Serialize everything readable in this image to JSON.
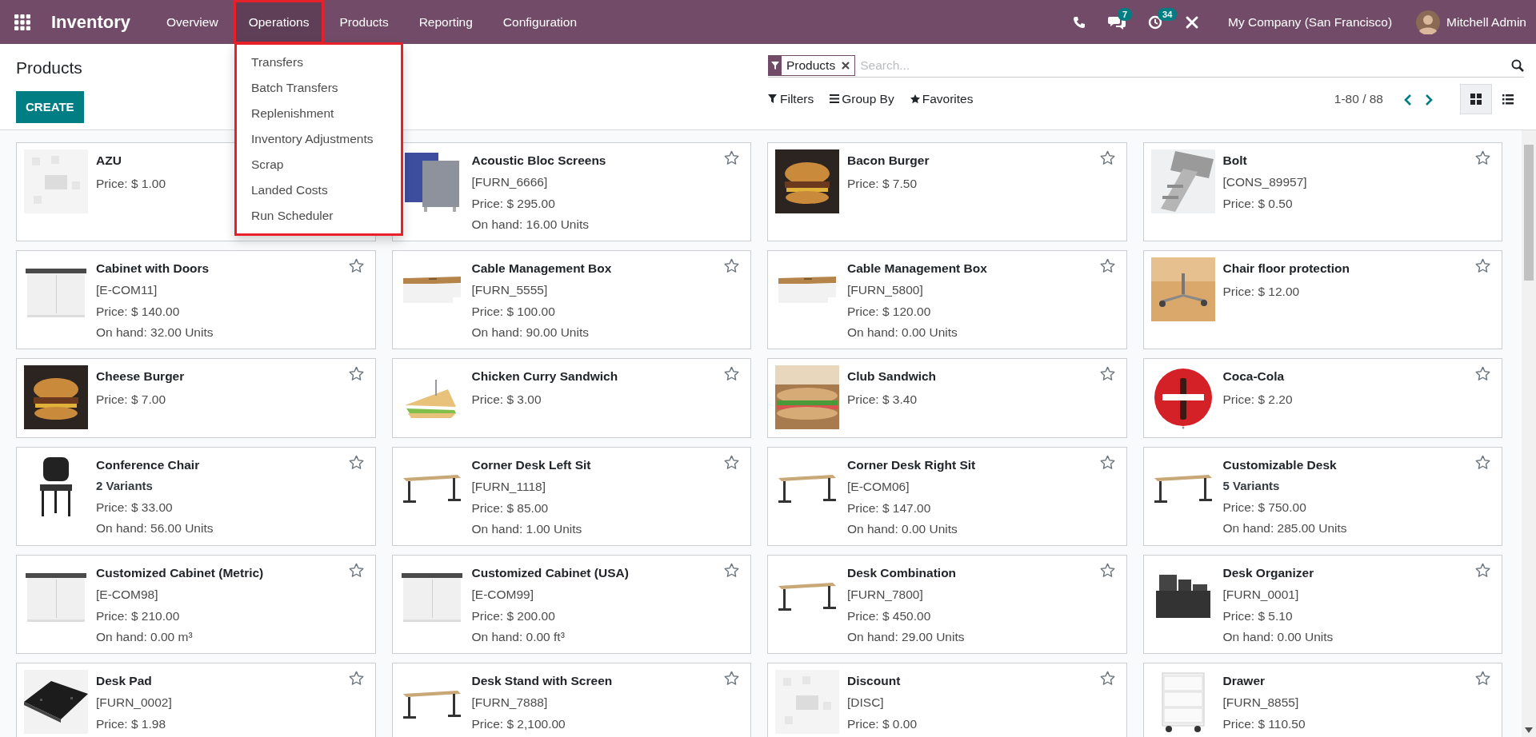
{
  "app": {
    "name": "Inventory"
  },
  "menu": [
    {
      "label": "Overview",
      "selected": false
    },
    {
      "label": "Operations",
      "selected": true
    },
    {
      "label": "Products",
      "selected": false
    },
    {
      "label": "Reporting",
      "selected": false
    },
    {
      "label": "Configuration",
      "selected": false
    }
  ],
  "dropdown": [
    "Transfers",
    "Batch Transfers",
    "Replenishment",
    "Inventory Adjustments",
    "Scrap",
    "Landed Costs",
    "Run Scheduler"
  ],
  "systray": {
    "chat_count": "7",
    "activity_count": "34",
    "company": "My Company (San Francisco)",
    "user": "Mitchell Admin"
  },
  "title": "Products",
  "create_button": "CREATE",
  "search": {
    "facet": "Products",
    "placeholder": "Search..."
  },
  "filters": [
    "Filters",
    "Group By",
    "Favorites"
  ],
  "pager": "1-80 / 88",
  "views": [
    {
      "kind": "kanban",
      "selected": true
    },
    {
      "kind": "list",
      "selected": false
    }
  ],
  "cards": [
    {
      "name": "AZU",
      "price": "Price: $ 1.00"
    },
    {
      "name": "Acoustic Bloc Screens",
      "code": "[FURN_6666]",
      "price": "Price: $ 295.00",
      "on_hand": "On hand: 16.00 Units"
    },
    {
      "name": "Bacon Burger",
      "price": "Price: $ 7.50"
    },
    {
      "name": "Bolt",
      "code": "[CONS_89957]",
      "price": "Price: $ 0.50"
    },
    {
      "name": "Cabinet with Doors",
      "code": "[E-COM11]",
      "price": "Price: $ 140.00",
      "on_hand": "On hand: 32.00 Units"
    },
    {
      "name": "Cable Management Box",
      "code": "[FURN_5555]",
      "price": "Price: $ 100.00",
      "on_hand": "On hand: 90.00 Units"
    },
    {
      "name": "Cable Management Box",
      "code": "[FURN_5800]",
      "price": "Price: $ 120.00",
      "on_hand": "On hand: 0.00 Units"
    },
    {
      "name": "Chair floor protection",
      "price": "Price: $ 12.00"
    },
    {
      "name": "Cheese Burger",
      "price": "Price: $ 7.00"
    },
    {
      "name": "Chicken Curry Sandwich",
      "price": "Price: $ 3.00"
    },
    {
      "name": "Club Sandwich",
      "price": "Price: $ 3.40"
    },
    {
      "name": "Coca-Cola",
      "price": "Price: $ 2.20"
    },
    {
      "name": "Conference Chair",
      "variants": "2 Variants",
      "price": "Price: $ 33.00",
      "on_hand": "On hand: 56.00 Units"
    },
    {
      "name": "Corner Desk Left Sit",
      "code": "[FURN_1118]",
      "price": "Price: $ 85.00",
      "on_hand": "On hand: 1.00 Units"
    },
    {
      "name": "Corner Desk Right Sit",
      "code": "[E-COM06]",
      "price": "Price: $ 147.00",
      "on_hand": "On hand: 0.00 Units"
    },
    {
      "name": "Customizable Desk",
      "variants": "5 Variants",
      "price": "Price: $ 750.00",
      "on_hand": "On hand: 285.00 Units"
    },
    {
      "name": "Customized Cabinet (Metric)",
      "code": "[E-COM98]",
      "price": "Price: $ 210.00",
      "on_hand": "On hand: 0.00 m³"
    },
    {
      "name": "Customized Cabinet (USA)",
      "code": "[E-COM99]",
      "price": "Price: $ 200.00",
      "on_hand": "On hand: 0.00 ft³"
    },
    {
      "name": "Desk Combination",
      "code": "[FURN_7800]",
      "price": "Price: $ 450.00",
      "on_hand": "On hand: 29.00 Units"
    },
    {
      "name": "Desk Organizer",
      "code": "[FURN_0001]",
      "price": "Price: $ 5.10",
      "on_hand": "On hand: 0.00 Units"
    },
    {
      "name": "Desk Pad",
      "code": "[FURN_0002]",
      "price": "Price: $ 1.98"
    },
    {
      "name": "Desk Stand with Screen",
      "code": "[FURN_7888]",
      "price": "Price: $ 2,100.00"
    },
    {
      "name": "Discount",
      "code": "[DISC]",
      "price": "Price: $ 0.00"
    },
    {
      "name": "Drawer",
      "code": "[FURN_8855]",
      "price": "Price: $ 110.50"
    }
  ]
}
